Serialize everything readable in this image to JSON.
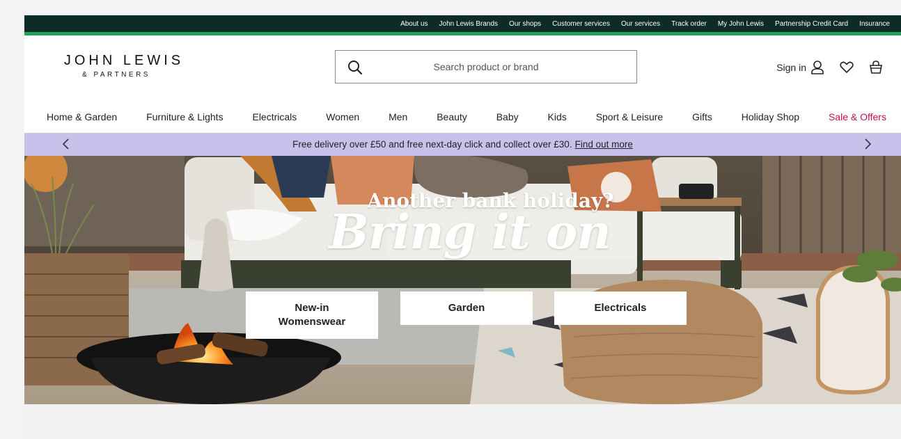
{
  "utility_links": [
    "About us",
    "John Lewis Brands",
    "Our shops",
    "Customer services",
    "Our services",
    "Track order",
    "My John Lewis",
    "Partnership Credit Card",
    "Insurance"
  ],
  "logo": {
    "line1": "JOHN LEWIS",
    "line2": "& PARTNERS"
  },
  "search": {
    "placeholder": "Search product or brand"
  },
  "account": {
    "signin_label": "Sign in"
  },
  "nav": {
    "items": [
      "Home & Garden",
      "Furniture & Lights",
      "Electricals",
      "Women",
      "Men",
      "Beauty",
      "Baby",
      "Kids",
      "Sport & Leisure",
      "Gifts",
      "Holiday Shop"
    ],
    "sale_label": "Sale & Offers"
  },
  "promo": {
    "text": "Free delivery over £50 and free next-day click and collect over £30.",
    "link": "Find out more"
  },
  "hero": {
    "headline": "Another bank holiday?",
    "subheadline": "Bring it on",
    "cta": [
      {
        "line1": "New-in",
        "line2": "Womenswear"
      },
      {
        "line1": "Garden",
        "line2": ""
      },
      {
        "line1": "Electricals",
        "line2": ""
      }
    ]
  },
  "colors": {
    "topbar": "#0d2b27",
    "accent_stripe": "#1fa35a",
    "promo": "#c9c1ec",
    "sale": "#c8104a"
  }
}
